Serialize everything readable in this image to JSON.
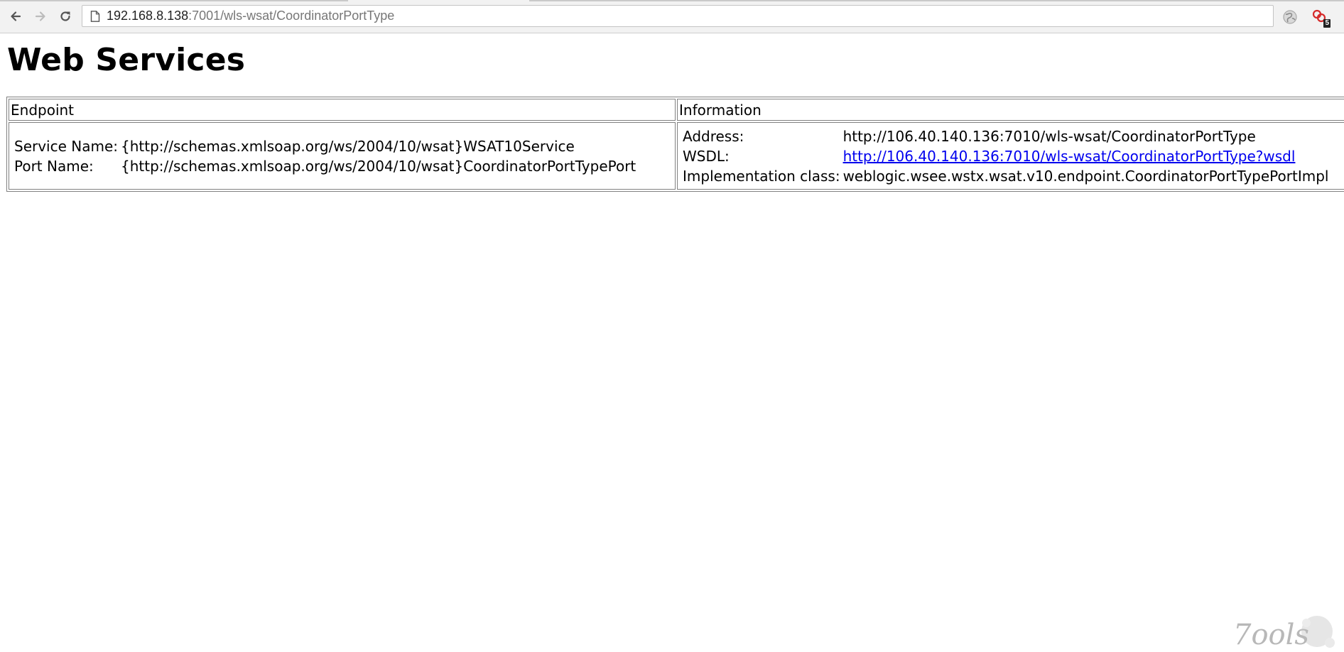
{
  "browser": {
    "url_host": "192.168.8.138",
    "url_rest": ":7001/wls-wsat/CoordinatorPortType",
    "extension_badge": "5",
    "icons": [
      "back-arrow-icon",
      "forward-arrow-icon",
      "reload-icon",
      "page-icon",
      "globe-icon",
      "extension-icon"
    ]
  },
  "page": {
    "title": "Web Services",
    "table": {
      "headers": {
        "endpoint": "Endpoint",
        "information": "Information"
      },
      "endpoint": {
        "service_name_label": "Service Name:",
        "service_name_value": "{http://schemas.xmlsoap.org/ws/2004/10/wsat}WSAT10Service",
        "port_name_label": "Port Name:",
        "port_name_value": "{http://schemas.xmlsoap.org/ws/2004/10/wsat}CoordinatorPortTypePort"
      },
      "information": {
        "address_label": "Address:",
        "address_value": "http://106.40.140.136:7010/wls-wsat/CoordinatorPortType",
        "wsdl_label": "WSDL:",
        "wsdl_value": "http://106.40.140.136:7010/wls-wsat/CoordinatorPortType?wsdl",
        "impl_label": "Implementation class:",
        "impl_value": "weblogic.wsee.wstx.wsat.v10.endpoint.CoordinatorPortTypePortImpl"
      }
    }
  },
  "watermark": {
    "text": "7ools"
  },
  "colors": {
    "link": "#0000ee",
    "toolbar_bg": "#f2f2f2",
    "border": "#808080"
  }
}
